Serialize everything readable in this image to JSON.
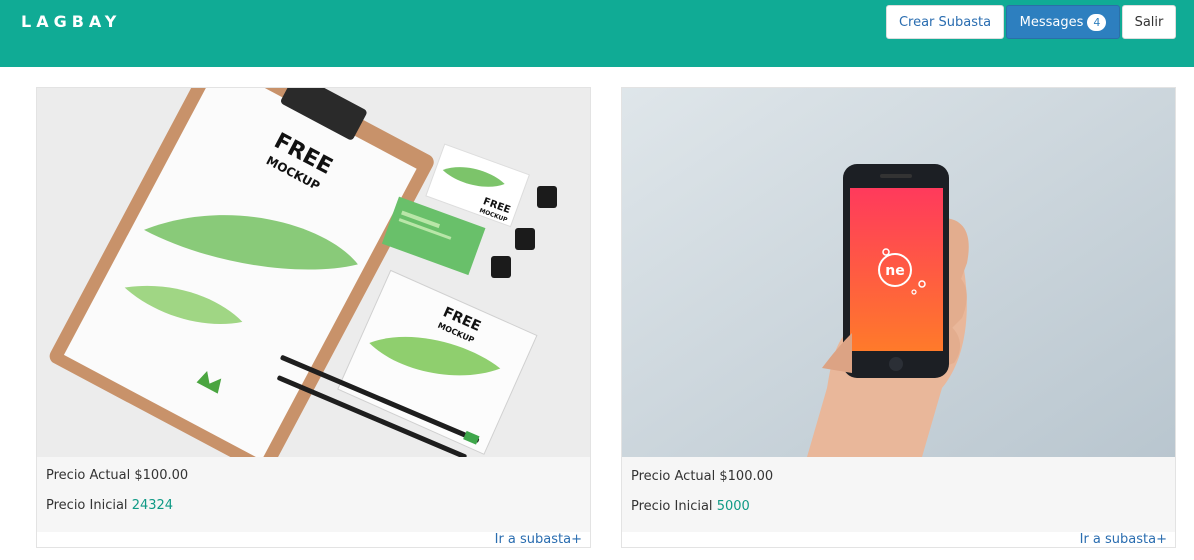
{
  "app": {
    "brand": "LAGBAY"
  },
  "nav": {
    "create_label": "Crear Subasta",
    "messages_label": "Messages",
    "messages_count": "4",
    "logout_label": "Salir"
  },
  "auctions": [
    {
      "current_label": "Precio Actual",
      "current_value": "$100.00",
      "initial_label": "Precio Inicial",
      "initial_value": "24324",
      "link_label": "Ir a subasta",
      "link_icon": "plus-icon",
      "image_texts": [
        "FREE",
        "MOCKUP",
        "FREE",
        "MOCKUP",
        "FREE",
        "MOCKUP"
      ]
    },
    {
      "current_label": "Precio Actual",
      "current_value": "$100.00",
      "initial_label": "Precio Inicial",
      "initial_value": "5000",
      "link_label": "Ir a subasta",
      "link_icon": "plus-icon",
      "image_texts": [
        "ne"
      ]
    }
  ],
  "colors": {
    "navbar": "#10ab95",
    "link": "#2a6db0",
    "price_initial": "#109a86",
    "messages_button": "#2d7fbf"
  }
}
